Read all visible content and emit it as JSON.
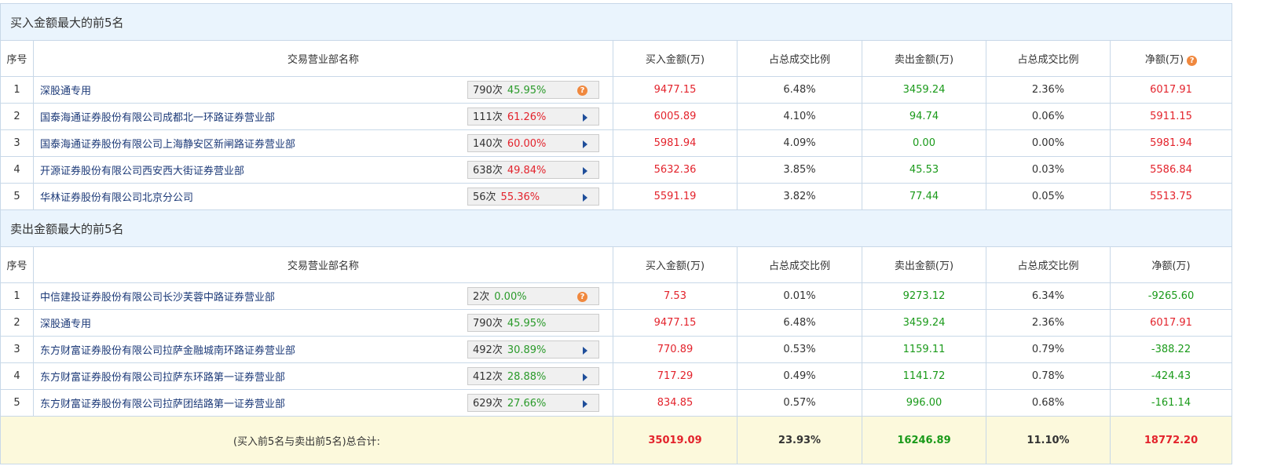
{
  "buy_section": {
    "title": "买入金额最大的前5名",
    "headers": [
      "序号",
      "交易营业部名称",
      "买入金额(万)",
      "占总成交比例",
      "卖出金额(万)",
      "占总成交比例",
      "净额(万)"
    ],
    "rows": [
      {
        "no": "1",
        "name": "深股通专用",
        "count": "790次",
        "rate": "45.95%",
        "rate_color": "green",
        "icon": "help-icon",
        "buy": "9477.15",
        "buy_pct": "6.48%",
        "sell": "3459.24",
        "sell_pct": "2.36%",
        "net": "6017.91",
        "net_color": "red"
      },
      {
        "no": "2",
        "name": "国泰海通证券股份有限公司成都北一环路证券营业部",
        "count": "111次",
        "rate": "61.26%",
        "rate_color": "red",
        "icon": "arrow-right-icon",
        "buy": "6005.89",
        "buy_pct": "4.10%",
        "sell": "94.74",
        "sell_pct": "0.06%",
        "net": "5911.15",
        "net_color": "red"
      },
      {
        "no": "3",
        "name": "国泰海通证券股份有限公司上海静安区新闸路证券营业部",
        "count": "140次",
        "rate": "60.00%",
        "rate_color": "red",
        "icon": "arrow-right-icon",
        "buy": "5981.94",
        "buy_pct": "4.09%",
        "sell": "0.00",
        "sell_pct": "0.00%",
        "net": "5981.94",
        "net_color": "red"
      },
      {
        "no": "4",
        "name": "开源证券股份有限公司西安西大街证券营业部",
        "count": "638次",
        "rate": "49.84%",
        "rate_color": "red",
        "icon": "arrow-right-icon",
        "buy": "5632.36",
        "buy_pct": "3.85%",
        "sell": "45.53",
        "sell_pct": "0.03%",
        "net": "5586.84",
        "net_color": "red"
      },
      {
        "no": "5",
        "name": "华林证券股份有限公司北京分公司",
        "count": "56次",
        "rate": "55.36%",
        "rate_color": "red",
        "icon": "arrow-right-icon",
        "buy": "5591.19",
        "buy_pct": "3.82%",
        "sell": "77.44",
        "sell_pct": "0.05%",
        "net": "5513.75",
        "net_color": "red"
      }
    ]
  },
  "sell_section": {
    "title": "卖出金额最大的前5名",
    "headers": [
      "序号",
      "交易营业部名称",
      "买入金额(万)",
      "占总成交比例",
      "卖出金额(万)",
      "占总成交比例",
      "净额(万)"
    ],
    "rows": [
      {
        "no": "1",
        "name": "中信建投证券股份有限公司长沙芙蓉中路证券营业部",
        "count": "2次",
        "rate": "0.00%",
        "rate_color": "green",
        "icon": "help-icon",
        "buy": "7.53",
        "buy_pct": "0.01%",
        "sell": "9273.12",
        "sell_pct": "6.34%",
        "net": "-9265.60",
        "net_color": "green"
      },
      {
        "no": "2",
        "name": "深股通专用",
        "count": "790次",
        "rate": "45.95%",
        "rate_color": "green",
        "icon": "none",
        "buy": "9477.15",
        "buy_pct": "6.48%",
        "sell": "3459.24",
        "sell_pct": "2.36%",
        "net": "6017.91",
        "net_color": "red"
      },
      {
        "no": "3",
        "name": "东方财富证券股份有限公司拉萨金融城南环路证券营业部",
        "count": "492次",
        "rate": "30.89%",
        "rate_color": "green",
        "icon": "arrow-right-icon",
        "buy": "770.89",
        "buy_pct": "0.53%",
        "sell": "1159.11",
        "sell_pct": "0.79%",
        "net": "-388.22",
        "net_color": "green"
      },
      {
        "no": "4",
        "name": "东方财富证券股份有限公司拉萨东环路第一证券营业部",
        "count": "412次",
        "rate": "28.88%",
        "rate_color": "green",
        "icon": "arrow-right-icon",
        "buy": "717.29",
        "buy_pct": "0.49%",
        "sell": "1141.72",
        "sell_pct": "0.78%",
        "net": "-424.43",
        "net_color": "green"
      },
      {
        "no": "5",
        "name": "东方财富证券股份有限公司拉萨团结路第一证券营业部",
        "count": "629次",
        "rate": "27.66%",
        "rate_color": "green",
        "icon": "arrow-right-icon",
        "buy": "834.85",
        "buy_pct": "0.57%",
        "sell": "996.00",
        "sell_pct": "0.68%",
        "net": "-161.14",
        "net_color": "green"
      }
    ]
  },
  "total": {
    "label": "(买入前5名与卖出前5名)总合计:",
    "buy": "35019.09",
    "buy_pct": "23.93%",
    "sell": "16246.89",
    "sell_pct": "11.10%",
    "net": "18772.20"
  },
  "help_glyph": "?"
}
